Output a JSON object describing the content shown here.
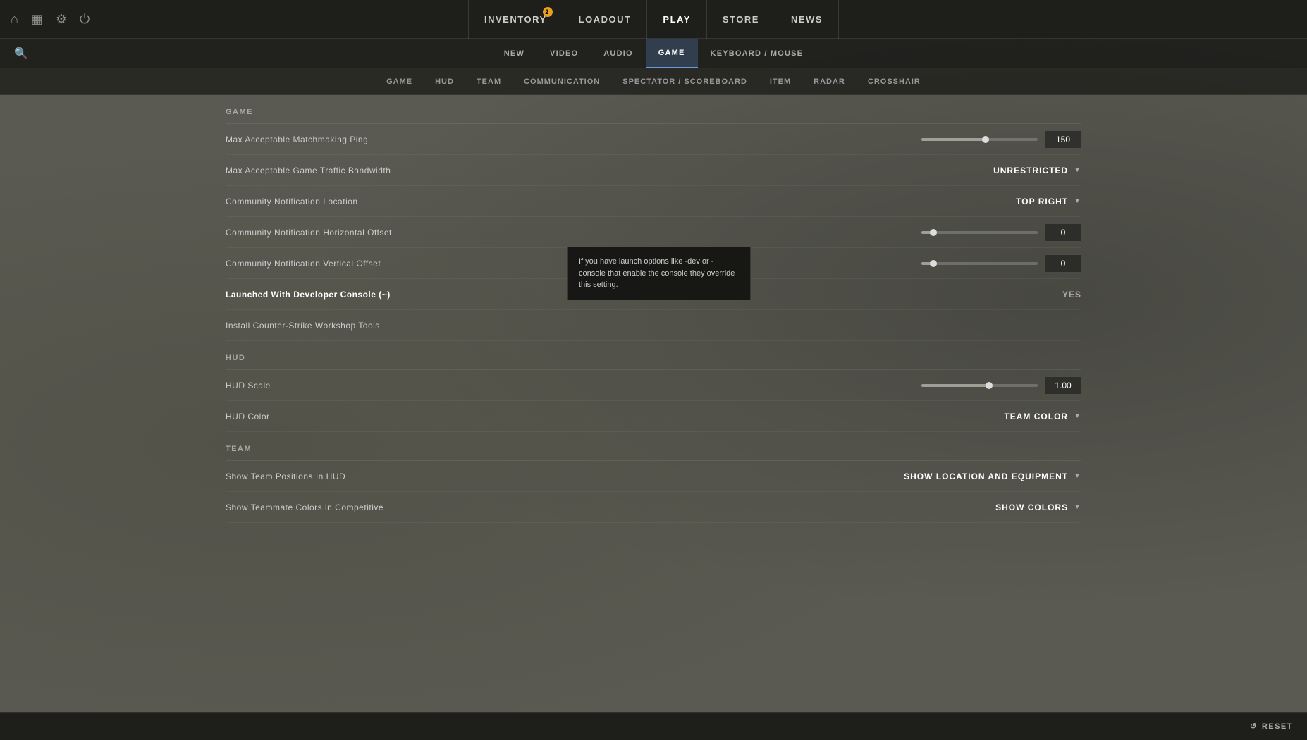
{
  "topNav": {
    "items": [
      {
        "id": "inventory",
        "label": "INVENTORY",
        "badge": "2",
        "active": false
      },
      {
        "id": "loadout",
        "label": "LOADOUT",
        "active": false
      },
      {
        "id": "play",
        "label": "PLAY",
        "active": true
      },
      {
        "id": "store",
        "label": "STORE",
        "active": false
      },
      {
        "id": "news",
        "label": "NEWS",
        "active": false
      }
    ],
    "icons": {
      "home": "⌂",
      "missions": "▦",
      "settings": "⚙",
      "power": "⏻"
    }
  },
  "secondaryNav": {
    "items": [
      {
        "id": "new",
        "label": "NEW",
        "active": false
      },
      {
        "id": "video",
        "label": "VIDEO",
        "active": false
      },
      {
        "id": "audio",
        "label": "AUDIO",
        "active": false
      },
      {
        "id": "game",
        "label": "GAME",
        "active": true
      },
      {
        "id": "keyboard",
        "label": "KEYBOARD / MOUSE",
        "active": false
      }
    ]
  },
  "subNav": {
    "items": [
      {
        "id": "game",
        "label": "GAME",
        "active": false
      },
      {
        "id": "hud",
        "label": "HUD",
        "active": false
      },
      {
        "id": "team",
        "label": "TEAM",
        "active": false
      },
      {
        "id": "communication",
        "label": "COMMUNICATION",
        "active": false
      },
      {
        "id": "spectator",
        "label": "SPECTATOR / SCOREBOARD",
        "active": false
      },
      {
        "id": "item",
        "label": "ITEM",
        "active": false
      },
      {
        "id": "radar",
        "label": "RADAR",
        "active": false
      },
      {
        "id": "crosshair",
        "label": "CROSSHAIR",
        "active": false
      }
    ]
  },
  "sections": {
    "game": {
      "header": "Game",
      "settings": [
        {
          "id": "ping",
          "label": "Max Acceptable Matchmaking Ping",
          "type": "slider",
          "value": "150",
          "fillPercent": 55
        },
        {
          "id": "bandwidth",
          "label": "Max Acceptable Game Traffic Bandwidth",
          "type": "dropdown",
          "value": "UNRESTRICTED"
        },
        {
          "id": "notif-location",
          "label": "Community Notification Location",
          "type": "dropdown",
          "value": "TOP RIGHT"
        },
        {
          "id": "notif-horiz",
          "label": "Community Notification Horizontal Offset",
          "type": "slider",
          "value": "0",
          "fillPercent": 10
        },
        {
          "id": "notif-vert",
          "label": "Community Notification Vertical Offset",
          "type": "slider",
          "value": "0",
          "fillPercent": 10
        },
        {
          "id": "dev-console",
          "label": "Launched With Developer Console (~)",
          "type": "value",
          "value": "YES",
          "bold": true
        },
        {
          "id": "workshop-tools",
          "label": "Install Counter-Strike Workshop Tools",
          "type": "none"
        }
      ]
    },
    "hud": {
      "header": "Hud",
      "settings": [
        {
          "id": "hud-scale",
          "label": "HUD Scale",
          "type": "slider",
          "value": "1.00",
          "fillPercent": 58
        },
        {
          "id": "hud-color",
          "label": "HUD Color",
          "type": "dropdown",
          "value": "TEAM COLOR"
        }
      ]
    },
    "team": {
      "header": "Team",
      "settings": [
        {
          "id": "team-positions",
          "label": "Show Team Positions In HUD",
          "type": "dropdown",
          "value": "SHOW LOCATION AND EQUIPMENT"
        },
        {
          "id": "teammate-colors",
          "label": "Show Teammate Colors in Competitive",
          "type": "dropdown",
          "value": "SHOW COLORS"
        }
      ]
    }
  },
  "tooltip": {
    "text": "If you have launch options like -dev or -console that enable the console they override this setting."
  },
  "bottomBar": {
    "resetLabel": "RESET"
  }
}
